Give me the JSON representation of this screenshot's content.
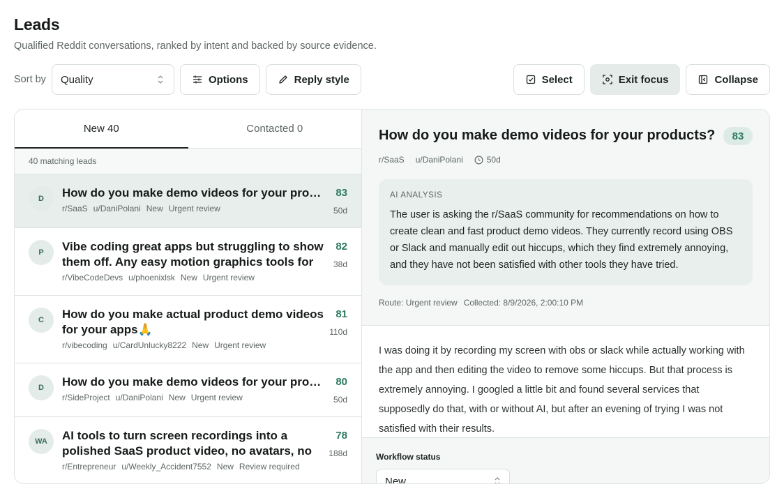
{
  "page": {
    "title": "Leads",
    "subtitle": "Qualified Reddit conversations, ranked by intent and backed by source evidence."
  },
  "toolbar": {
    "sort_label": "Sort by",
    "sort_value": "Quality",
    "options_label": "Options",
    "reply_style_label": "Reply style",
    "select_label": "Select",
    "exit_focus_label": "Exit focus",
    "collapse_label": "Collapse"
  },
  "tabs": [
    {
      "label": "New 40",
      "active": true
    },
    {
      "label": "Contacted 0",
      "active": false
    }
  ],
  "list": {
    "count_text": "40 matching leads",
    "leads": [
      {
        "avatar": "D",
        "title": "How do you make demo videos for your products?",
        "subreddit": "r/SaaS",
        "user": "u/DaniPolani",
        "status": "New",
        "route": "Urgent review",
        "score": "83",
        "age": "50d"
      },
      {
        "avatar": "P",
        "title": "Vibe coding great apps but struggling to show them off. Any easy motion graphics tools for dev…",
        "subreddit": "r/VibeCodeDevs",
        "user": "u/phoenixlsk",
        "status": "New",
        "route": "Urgent review",
        "score": "82",
        "age": "38d"
      },
      {
        "avatar": "C",
        "title": "How do you make actual product demo videos for your apps🙏",
        "subreddit": "r/vibecoding",
        "user": "u/CardUnlucky8222",
        "status": "New",
        "route": "Urgent review",
        "score": "81",
        "age": "110d"
      },
      {
        "avatar": "D",
        "title": "How do you make demo videos for your products?",
        "subreddit": "r/SideProject",
        "user": "u/DaniPolani",
        "status": "New",
        "route": "Urgent review",
        "score": "80",
        "age": "50d"
      },
      {
        "avatar": "WA",
        "title": "AI tools to turn screen recordings into a polished SaaS product video, no avatars, no AI voice",
        "subreddit": "r/Entrepreneur",
        "user": "u/Weekly_Accident7552",
        "status": "New",
        "route": "Review required",
        "score": "78",
        "age": "188d"
      }
    ]
  },
  "detail": {
    "title": "How do you make demo videos for your products?",
    "score": "83",
    "subreddit": "r/SaaS",
    "user": "u/DaniPolani",
    "age": "50d",
    "analysis_label": "AI ANALYSIS",
    "analysis_text": "The user is asking the r/SaaS community for recommendations on how to create clean and fast product demo videos. They currently record using OBS or Slack and manually edit out hiccups, which they find extremely annoying, and they have not been satisfied with other tools they have tried.",
    "route": "Route: Urgent review",
    "collected": "Collected: 8/9/2026, 2:00:10 PM",
    "source_text": "I was doing it by recording my screen with obs or slack while actually working with the app and then editing the video to remove some hiccups. But that process is extremely annoying. I googled a little bit and found several services that supposedly do that, with or without AI, but after an evening of trying I was not satisfied with their results.",
    "workflow_label": "Workflow status",
    "workflow_value": "New"
  }
}
